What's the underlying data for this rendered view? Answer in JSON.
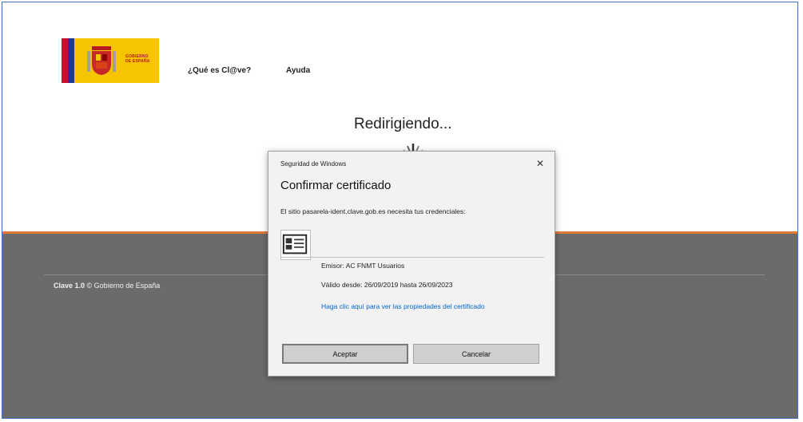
{
  "header": {
    "logo_text_line1": "GOBIERNO",
    "logo_text_line2": "DE ESPAÑA",
    "nav": [
      {
        "label": "¿Qué es Cl@ve?"
      },
      {
        "label": "Ayuda"
      }
    ]
  },
  "main": {
    "status_text": "Redirigiendo..."
  },
  "footer": {
    "brand": "Clave 1.0",
    "copyright": "© Gobierno de España"
  },
  "dialog": {
    "caption": "Seguridad de Windows",
    "close_symbol": "✕",
    "heading": "Confirmar certificado",
    "message": "El sitio pasarela-ident.clave.gob.es necesita tus credenciales:",
    "issuer": "Emisor: AC FNMT Usuarios",
    "validity": "Válido desde: 26/09/2019 hasta 26/09/2023",
    "properties_link": "Haga clic aquí para ver las propiedades del certificado",
    "accept_label": "Aceptar",
    "cancel_label": "Cancelar",
    "icon": "certificate-icon"
  },
  "colors": {
    "footer_bg": "#6b6b6b",
    "accent_orange": "#e07b39",
    "logo_yellow": "#f6c400",
    "link_blue": "#0066cc"
  }
}
